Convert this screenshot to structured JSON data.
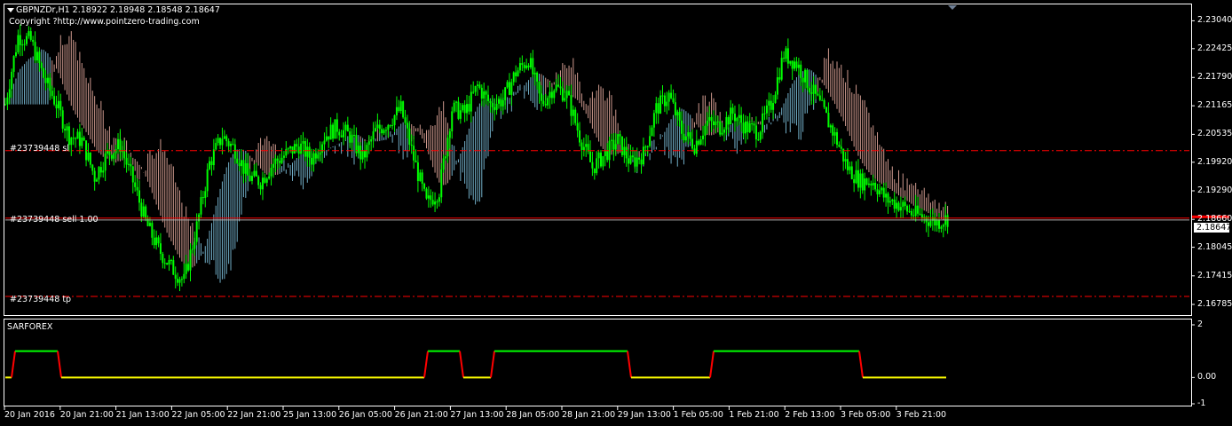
{
  "header": {
    "symbol_line": "GBPNZDr,H1  2.18922 2.18948 2.18548 2.18647",
    "copyright": "Copyright ?http://www.pointzero-trading.com"
  },
  "order_labels": {
    "stop": "#23739448 sl",
    "entry": "#23739448 sell 1.00",
    "tp": "#23739448 tp"
  },
  "indicator": {
    "name": "SARFOREX"
  },
  "current_price": "2.18647",
  "colors": {
    "background": "#000000",
    "grid": "#ffffff",
    "candles": "#00ff00",
    "cloud_up": "#87ceeb",
    "cloud_down": "#f4b6a8",
    "order_line": "#ff0000",
    "indicator_high": "#00ff00",
    "indicator_low": "#ffff00",
    "indicator_transition": "#ff0000"
  },
  "chart_data": [
    {
      "type": "candlestick",
      "title": "GBPNZDr,H1",
      "ylim": [
        2.1655,
        2.234
      ],
      "y_ticks": [
        "2.23040",
        "2.22425",
        "2.21790",
        "2.21165",
        "2.20535",
        "2.19920",
        "2.19290",
        "2.18660",
        "2.18045",
        "2.17415",
        "2.16785"
      ],
      "x_ticks": [
        "20 Jan 2016",
        "20 Jan 21:00",
        "21 Jan 13:00",
        "22 Jan 05:00",
        "22 Jan 21:00",
        "25 Jan 13:00",
        "26 Jan 05:00",
        "26 Jan 21:00",
        "27 Jan 13:00",
        "28 Jan 05:00",
        "28 Jan 21:00",
        "29 Jan 13:00",
        "1 Feb 05:00",
        "1 Feb 21:00",
        "2 Feb 13:00",
        "3 Feb 05:00",
        "3 Feb 21:00"
      ],
      "close_trace": [
        2.212,
        2.227,
        2.226,
        2.218,
        2.212,
        2.205,
        2.204,
        2.196,
        2.201,
        2.203,
        2.195,
        2.186,
        2.18,
        2.176,
        2.173,
        2.185,
        2.199,
        2.205,
        2.202,
        2.196,
        2.195,
        2.199,
        2.201,
        2.203,
        2.2,
        2.205,
        2.207,
        2.205,
        2.2,
        2.206,
        2.208,
        2.211,
        2.2,
        2.19,
        2.193,
        2.211,
        2.21,
        2.216,
        2.212,
        2.213,
        2.219,
        2.222,
        2.212,
        2.216,
        2.214,
        2.205,
        2.198,
        2.201,
        2.204,
        2.199,
        2.201,
        2.211,
        2.214,
        2.206,
        2.203,
        2.208,
        2.207,
        2.21,
        2.207,
        2.206,
        2.212,
        2.223,
        2.221,
        2.216,
        2.211,
        2.205,
        2.198,
        2.195,
        2.195,
        2.191,
        2.19,
        2.188,
        2.187,
        2.186,
        2.187
      ],
      "order_levels": {
        "stop": 2.20175,
        "entry": 2.18687,
        "take_profit": 2.1696
      },
      "current_price": 2.18647
    },
    {
      "type": "line",
      "title": "SARFOREX",
      "ylim": [
        -1,
        2
      ],
      "y_ticks": [
        "2",
        "0.00",
        "-1"
      ],
      "segments": [
        {
          "from": "20 Jan 2016",
          "value": 0
        },
        {
          "from": "20 Jan 03:00",
          "value": 1
        },
        {
          "from": "20 Jan 13:00",
          "value": 0
        },
        {
          "from": "26 Jan 21:00",
          "value": 1
        },
        {
          "from": "27 Jan 07:00",
          "value": 0
        },
        {
          "from": "27 Jan 13:00",
          "value": 1
        },
        {
          "from": "29 Jan 11:00",
          "value": 0
        },
        {
          "from": "1 Feb 05:00",
          "value": 1
        },
        {
          "from": "3 Feb 03:00",
          "value": 0
        }
      ]
    }
  ]
}
